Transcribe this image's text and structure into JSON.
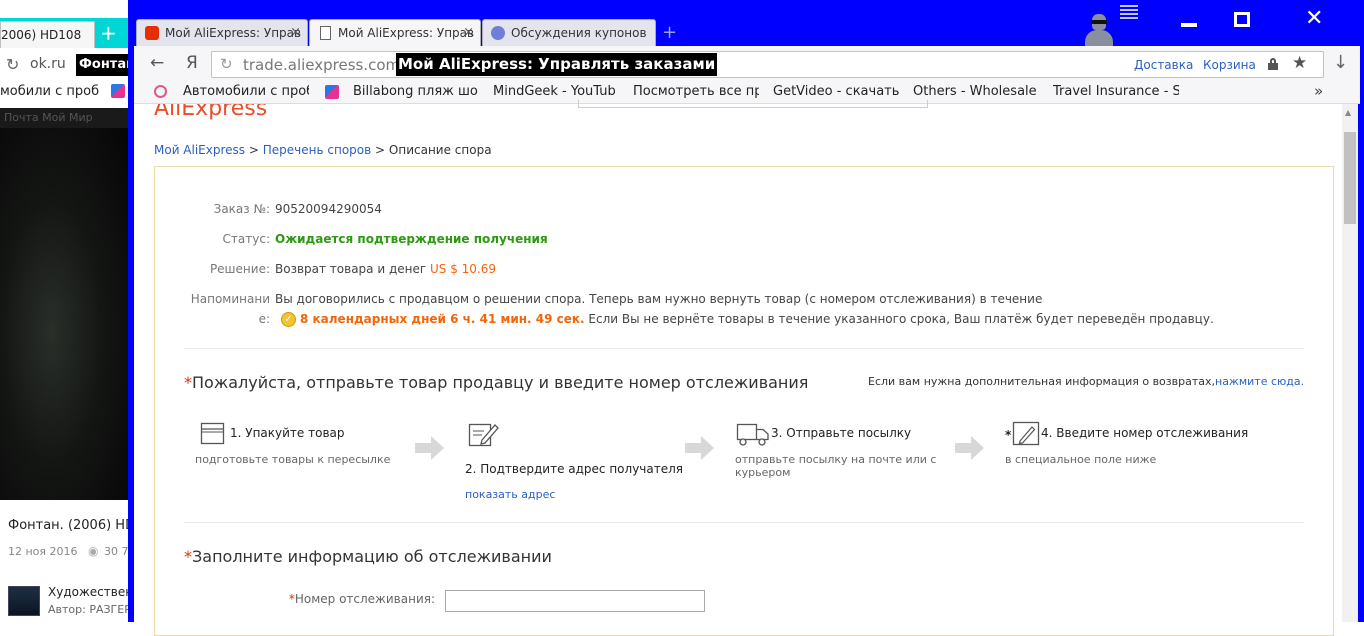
{
  "background_window": {
    "tab_title": "2006) HD108",
    "new_tab": "+",
    "url": "ok.ru",
    "page_title": "Фонтан",
    "bookmark": "мобили с проб",
    "nav_text": "Почта     Мой Мир",
    "video_title": "Фонтан. (2006) HD",
    "video_date": "12 ноя 2016",
    "video_views": "30 7",
    "item_title": "Художествен",
    "item_author": "Автор: РАЗГЕР"
  },
  "tabs": [
    {
      "label": "Мой AliExpress: Управ",
      "icon": "aliexpress-icon",
      "close": "×"
    },
    {
      "label": "Мой AliExpress: Управ",
      "icon": "page-icon",
      "close": "×"
    },
    {
      "label": "Обсуждения купонов",
      "icon": "forum-icon",
      "close": ""
    }
  ],
  "new_tab": "+",
  "window_controls": {
    "close": "✕"
  },
  "addressbar": {
    "back": "←",
    "yandex": "Я",
    "reload": "↻",
    "url": "trade.aliexpress.com",
    "title_overlay": "Мой AliExpress: Управлять заказами",
    "link_delivery": "Доставка",
    "link_cart": "Корзина",
    "star": "★",
    "download": "↓"
  },
  "bookmarks": [
    "Автомобили с проб",
    "Billabong пляж шор",
    "MindGeek - YouTub",
    "Посмотреть все пр",
    "GetVideo - скачать",
    "Others - Wholesale",
    "Travel Insurance - S"
  ],
  "bookmarks_more": "»",
  "page": {
    "logo_partial": "AliExpress",
    "breadcrumb": {
      "item1": "Мой AliExpress",
      "sep": ">",
      "item2": "Перечень споров",
      "item3": "Описание спора"
    },
    "order_label": "Заказ №:",
    "order_value": "90520094290054",
    "status_label": "Статус:",
    "status_value": "Ожидается подтверждение получения",
    "decision_label": "Решение:",
    "decision_value": "Возврат товара и денег",
    "decision_amount": "US $ 10.69",
    "reminder_label_1": "Напоминани",
    "reminder_label_2": "е:",
    "reminder_line1": "Вы договорились с продавцом о решении спора. Теперь вам нужно вернуть товар (с номером отслеживания) в течение",
    "reminder_icon": "✓",
    "reminder_time": "8 календарных дней 6 ч. 41 мин. 49 сек.",
    "reminder_tail": "Если Вы не вернёте товары в течение указанного срока, Ваш платёж будет переведён продавцу.",
    "section1_star": "*",
    "section1_title": "Пожалуйста, отправьте товар продавцу и введите номер отслеживания",
    "help_text": "Если вам нужна дополнительная информация о возвратах,",
    "help_link": "нажмите сюда.",
    "steps": [
      {
        "title": "1. Упакуйте товар",
        "sub": "подготовьте товары к пересылке"
      },
      {
        "title": "2. Подтвердите адрес получателя",
        "sub": "показать адрес"
      },
      {
        "title": "3. Отправьте посылку",
        "sub": "отправьте посылку на почте или с курьером"
      },
      {
        "title": "4. Введите номер отслеживания",
        "sub": "в специальное поле ниже",
        "star": "*"
      }
    ],
    "section2_star": "*",
    "section2_title": "Заполните информацию об отслеживании",
    "tracking_label_star": "*",
    "tracking_label": "Номер отслеживания:",
    "tracking_value": ""
  },
  "colors": {
    "window_frame": "#0000ff",
    "status_green": "#2d9a12",
    "amount_orange": "#f46408",
    "link_blue": "#2b5fc2",
    "required_red": "#e62e04"
  }
}
